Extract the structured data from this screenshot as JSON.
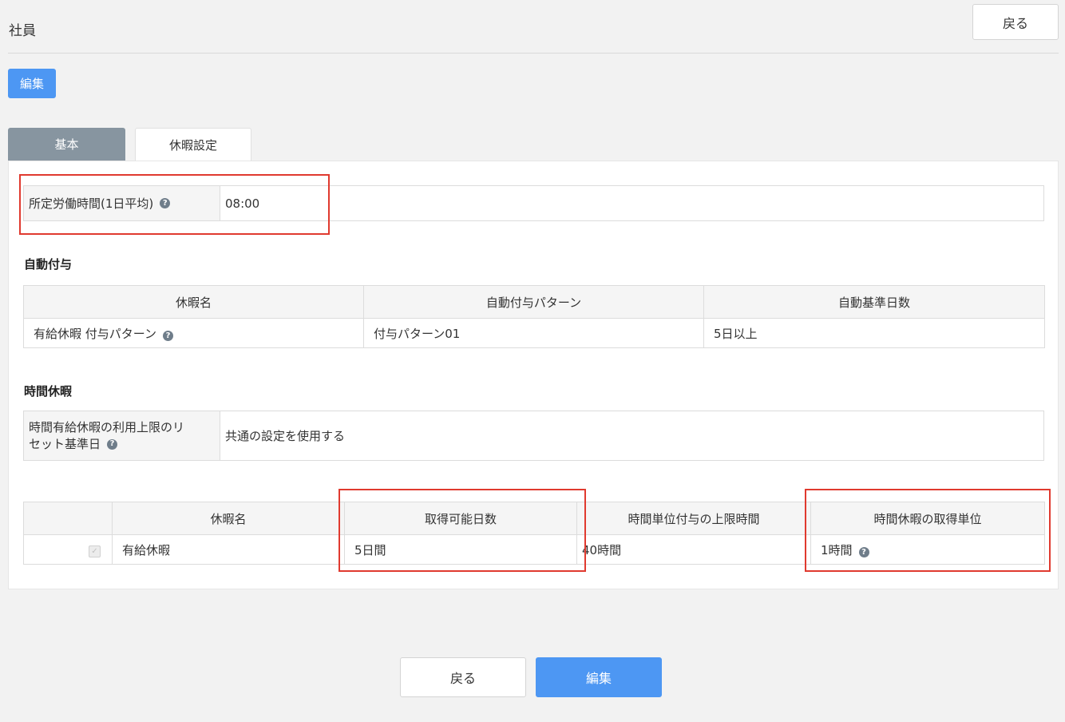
{
  "header": {
    "title": "社員",
    "back_label": "戻る"
  },
  "toolbar": {
    "edit_label": "編集"
  },
  "tabs": [
    {
      "label": "基本"
    },
    {
      "label": "休暇設定"
    }
  ],
  "work_hours": {
    "label": "所定労働時間(1日平均)",
    "value": "08:00"
  },
  "auto_grant": {
    "title": "自動付与",
    "headers": [
      "休暇名",
      "自動付与パターン",
      "自動基準日数"
    ],
    "row": {
      "name": "有給休暇 付与パターン",
      "pattern": "付与パターン01",
      "days": "5日以上"
    }
  },
  "hourly_leave": {
    "title": "時間休暇",
    "label_line1": "時間有給休暇の利用上限のリ",
    "label_line2": "セット基準日",
    "value": "共通の設定を使用する"
  },
  "leave_table": {
    "headers": [
      "休暇名",
      "取得可能日数",
      "時間単位付与の上限時間",
      "時間休暇の取得単位"
    ],
    "row": {
      "name": "有給休暇",
      "available_days": "5日間",
      "hour_limit": "40時間",
      "unit": "1時間"
    }
  },
  "footer": {
    "back_label": "戻る",
    "edit_label": "編集"
  },
  "colors": {
    "accent": "#4d97f3",
    "highlight": "#e03a2f",
    "tab_inactive": "#8795a0"
  }
}
